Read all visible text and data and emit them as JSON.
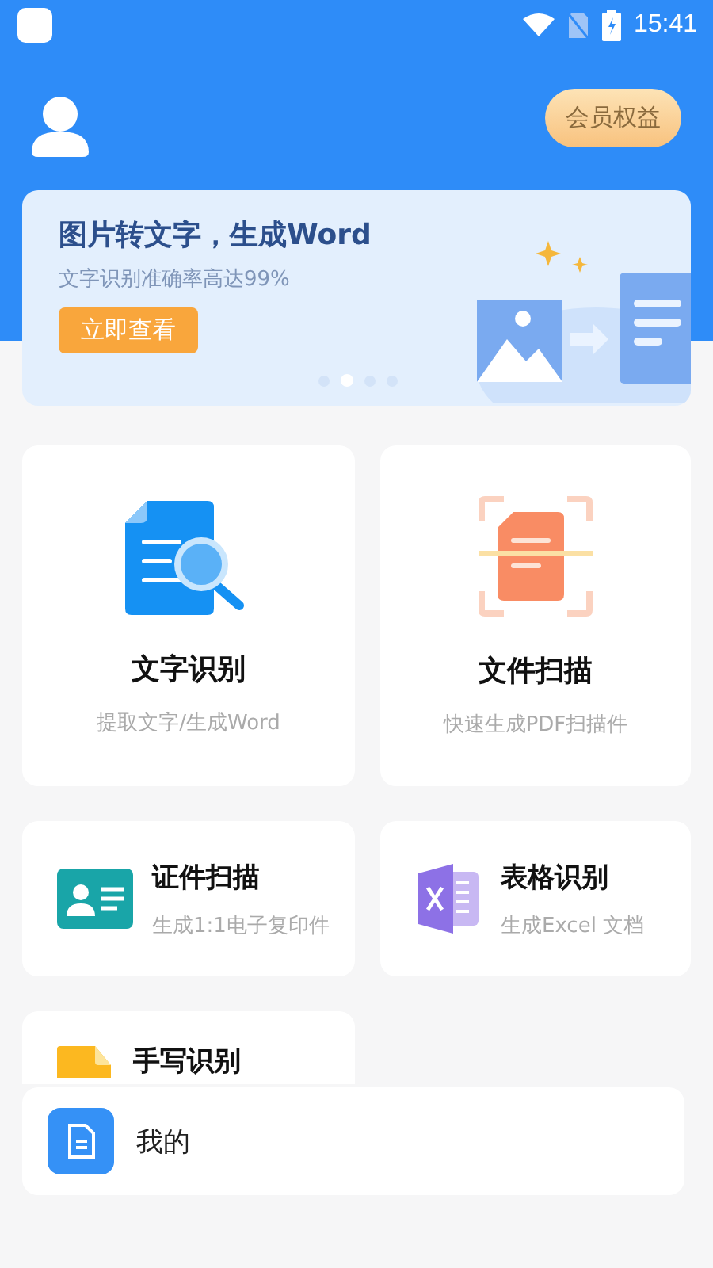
{
  "status_bar": {
    "time": "15:41"
  },
  "header": {
    "member_button": "会员权益"
  },
  "banner": {
    "title": "图片转文字，生成Word",
    "subtitle": "文字识别准确率高达99%",
    "button": "立即查看",
    "dots": [
      {
        "selected": false
      },
      {
        "selected": true
      },
      {
        "selected": false
      },
      {
        "selected": false
      }
    ]
  },
  "large_tools": [
    {
      "kind": "ocr",
      "title": "文字识别",
      "subtitle": "提取文字/生成Word"
    },
    {
      "kind": "scan",
      "title": "文件扫描",
      "subtitle": "快速生成PDF扫描件"
    }
  ],
  "small_tools": [
    {
      "kind": "id",
      "title": "证件扫描",
      "subtitle": "生成1:1电子复印件"
    },
    {
      "kind": "excel",
      "title": "表格识别",
      "subtitle": "生成Excel 文档"
    },
    {
      "kind": "handwriting",
      "title": "手写识别"
    }
  ],
  "documents_bar": {
    "label": "我的"
  }
}
